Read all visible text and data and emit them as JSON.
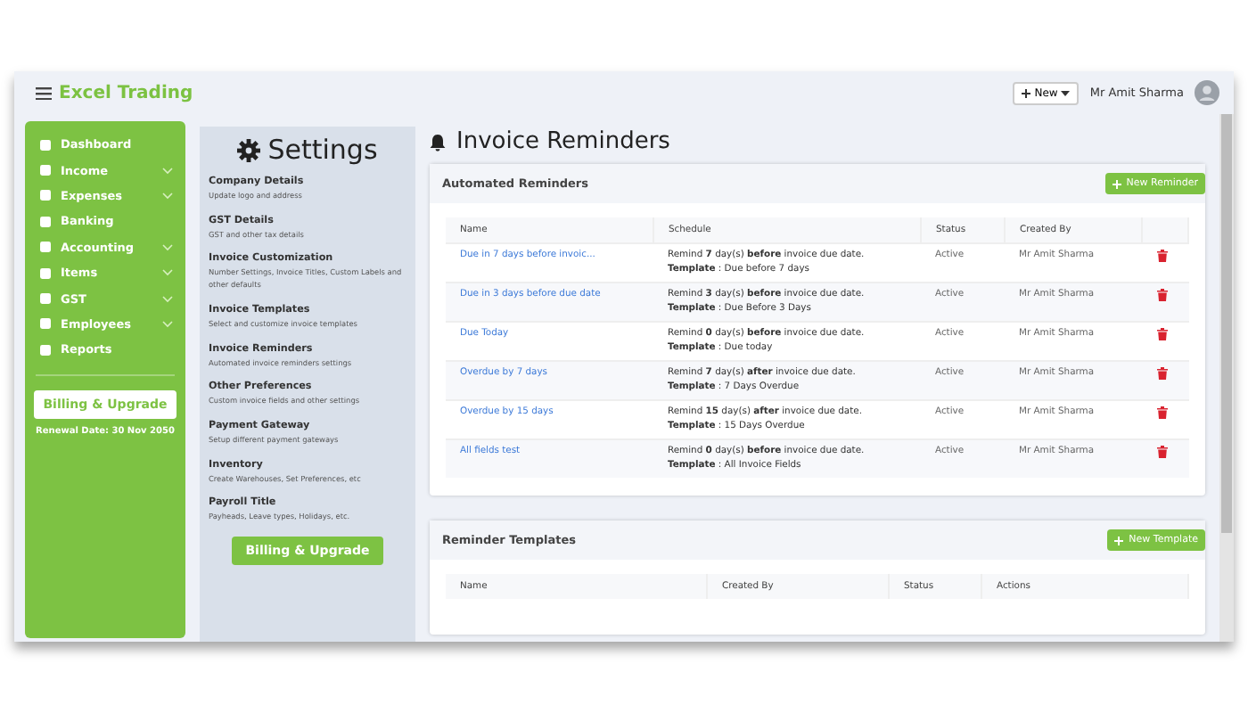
{
  "app": {
    "brand": "Excel Trading",
    "new_button": "New",
    "user_name": "Mr Amit Sharma"
  },
  "sidebar": {
    "items": [
      {
        "label": "Dashboard",
        "expandable": false
      },
      {
        "label": "Income",
        "expandable": true
      },
      {
        "label": "Expenses",
        "expandable": true
      },
      {
        "label": "Banking",
        "expandable": false
      },
      {
        "label": "Accounting",
        "expandable": true
      },
      {
        "label": "Items",
        "expandable": true
      },
      {
        "label": "GST",
        "expandable": true
      },
      {
        "label": "Employees",
        "expandable": true
      },
      {
        "label": "Reports",
        "expandable": false
      }
    ],
    "billing_button": "Billing & Upgrade",
    "renewal": "Renewal Date: 30 Nov 2050"
  },
  "settings": {
    "title": "Settings",
    "items": [
      {
        "title": "Company Details",
        "description": "Update logo and address"
      },
      {
        "title": "GST Details",
        "description": "GST and other tax details"
      },
      {
        "title": "Invoice Customization",
        "description": "Number Settings, Invoice Titles, Custom Labels and other defaults"
      },
      {
        "title": "Invoice Templates",
        "description": "Select and customize invoice templates"
      },
      {
        "title": "Invoice Reminders",
        "description": "Automated invoice reminders settings"
      },
      {
        "title": "Other Preferences",
        "description": "Custom invoice fields and other settings"
      },
      {
        "title": "Payment Gateway",
        "description": "Setup different payment gateways"
      },
      {
        "title": "Inventory",
        "description": "Create Warehouses, Set Preferences, etc"
      },
      {
        "title": "Payroll Title",
        "description": "Payheads, Leave types, Holidays, etc."
      }
    ],
    "billing_button": "Billing & Upgrade"
  },
  "page_title": "Invoice Reminders",
  "automated_reminders": {
    "title": "Automated Reminders",
    "button": "New Reminder",
    "columns": [
      "Name",
      "Schedule",
      "Status",
      "Created By"
    ],
    "rows": [
      {
        "name": "Due in 7 days before invoic...",
        "schedule": "Remind **7** day(s) **before** invoice due date.",
        "template": "**Template** : Due before 7 days",
        "status": "Active",
        "created_by": "Mr Amit Sharma"
      },
      {
        "name": "Due in 3 days before due date",
        "schedule": "Remind **3** day(s) **before** invoice due date.",
        "template": "**Template** : Due Before 3 Days",
        "status": "Active",
        "created_by": "Mr Amit Sharma"
      },
      {
        "name": "Due Today",
        "schedule": "Remind **0** day(s) **before** invoice due date.",
        "template": "**Template** : Due today",
        "status": "Active",
        "created_by": "Mr Amit Sharma"
      },
      {
        "name": "Overdue by 7 days",
        "schedule": "Remind **7** day(s) **after** invoice due date.",
        "template": "**Template** : 7 Days Overdue",
        "status": "Active",
        "created_by": "Mr Amit Sharma"
      },
      {
        "name": "Overdue by 15 days",
        "schedule": "Remind **15** day(s) **after** invoice due date.",
        "template": "**Template** : 15 Days Overdue",
        "status": "Active",
        "created_by": "Mr Amit Sharma"
      },
      {
        "name": "All fields test",
        "schedule": "Remind **0** day(s) **before** invoice due date.",
        "template": "**Template** : All Invoice Fields",
        "status": "Active",
        "created_by": "Mr Amit Sharma"
      }
    ]
  },
  "reminder_templates": {
    "title": "Reminder Templates",
    "button": "New Template",
    "columns": [
      "Name",
      "Created By",
      "Status",
      "Actions"
    ]
  }
}
